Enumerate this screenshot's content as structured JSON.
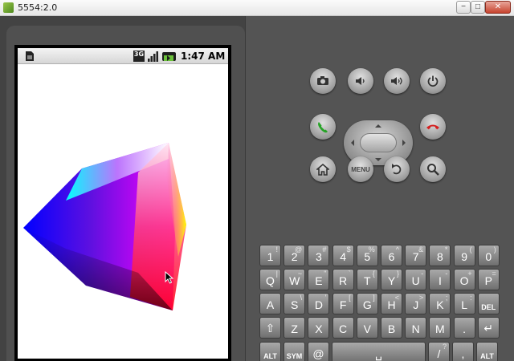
{
  "window": {
    "title": "5554:2.0",
    "minimize": "−",
    "maximize": "□",
    "close": "✕"
  },
  "statusbar": {
    "network": "3G",
    "time": "1:47 AM"
  },
  "hardware": {
    "menu_label": "MENU"
  },
  "keyboard": {
    "rows": [
      [
        {
          "k": "1",
          "a": "!"
        },
        {
          "k": "2",
          "a": "@"
        },
        {
          "k": "3",
          "a": "#"
        },
        {
          "k": "4",
          "a": "$"
        },
        {
          "k": "5",
          "a": "%"
        },
        {
          "k": "6",
          "a": "^"
        },
        {
          "k": "7",
          "a": "&"
        },
        {
          "k": "8",
          "a": "*"
        },
        {
          "k": "9",
          "a": "("
        },
        {
          "k": "0",
          "a": ")"
        }
      ],
      [
        {
          "k": "Q",
          "a": "|"
        },
        {
          "k": "W",
          "a": "~"
        },
        {
          "k": "E",
          "a": "\""
        },
        {
          "k": "R",
          "a": "`"
        },
        {
          "k": "T",
          "a": "{"
        },
        {
          "k": "Y",
          "a": "}"
        },
        {
          "k": "U",
          "a": "-"
        },
        {
          "k": "I",
          "a": "-"
        },
        {
          "k": "O",
          "a": "+"
        },
        {
          "k": "P",
          "a": "="
        }
      ],
      [
        {
          "k": "A",
          "a": ""
        },
        {
          "k": "S",
          "a": "\\"
        },
        {
          "k": "D",
          "a": "'"
        },
        {
          "k": "F",
          "a": "["
        },
        {
          "k": "G",
          "a": "]"
        },
        {
          "k": "H",
          "a": "<"
        },
        {
          "k": "J",
          "a": ">"
        },
        {
          "k": "K",
          "a": ";"
        },
        {
          "k": "L",
          "a": ":"
        },
        {
          "k": "DEL",
          "a": ""
        }
      ],
      [
        {
          "k": "⇧",
          "a": ""
        },
        {
          "k": "Z",
          "a": ""
        },
        {
          "k": "X",
          "a": ""
        },
        {
          "k": "C",
          "a": ""
        },
        {
          "k": "V",
          "a": ""
        },
        {
          "k": "B",
          "a": ""
        },
        {
          "k": "N",
          "a": ""
        },
        {
          "k": "M",
          "a": ""
        },
        {
          "k": ".",
          "a": ""
        },
        {
          "k": "↵",
          "a": ""
        }
      ],
      [
        {
          "k": "ALT",
          "a": ""
        },
        {
          "k": "SYM",
          "a": ""
        },
        {
          "k": "@",
          "a": ""
        },
        {
          "k": "␣",
          "a": ""
        },
        {
          "k": "/",
          "a": "?"
        },
        {
          "k": ",",
          "a": ""
        },
        {
          "k": "ALT",
          "a": ""
        }
      ]
    ]
  },
  "colors": {
    "emulator_body": "#434343",
    "screen_bg": "#ffffff",
    "cube_colors": [
      "#0000ff",
      "#00ffff",
      "#ffffff",
      "#ffff00",
      "#ff0000",
      "#000000",
      "#ff00ff"
    ]
  },
  "icons": [
    "sim-icon",
    "3g-icon",
    "signal-icon",
    "battery-icon",
    "camera-icon",
    "volume-down-icon",
    "volume-up-icon",
    "power-icon",
    "call-icon",
    "end-call-icon",
    "home-icon",
    "back-icon",
    "search-icon",
    "mouse-cursor-icon"
  ]
}
